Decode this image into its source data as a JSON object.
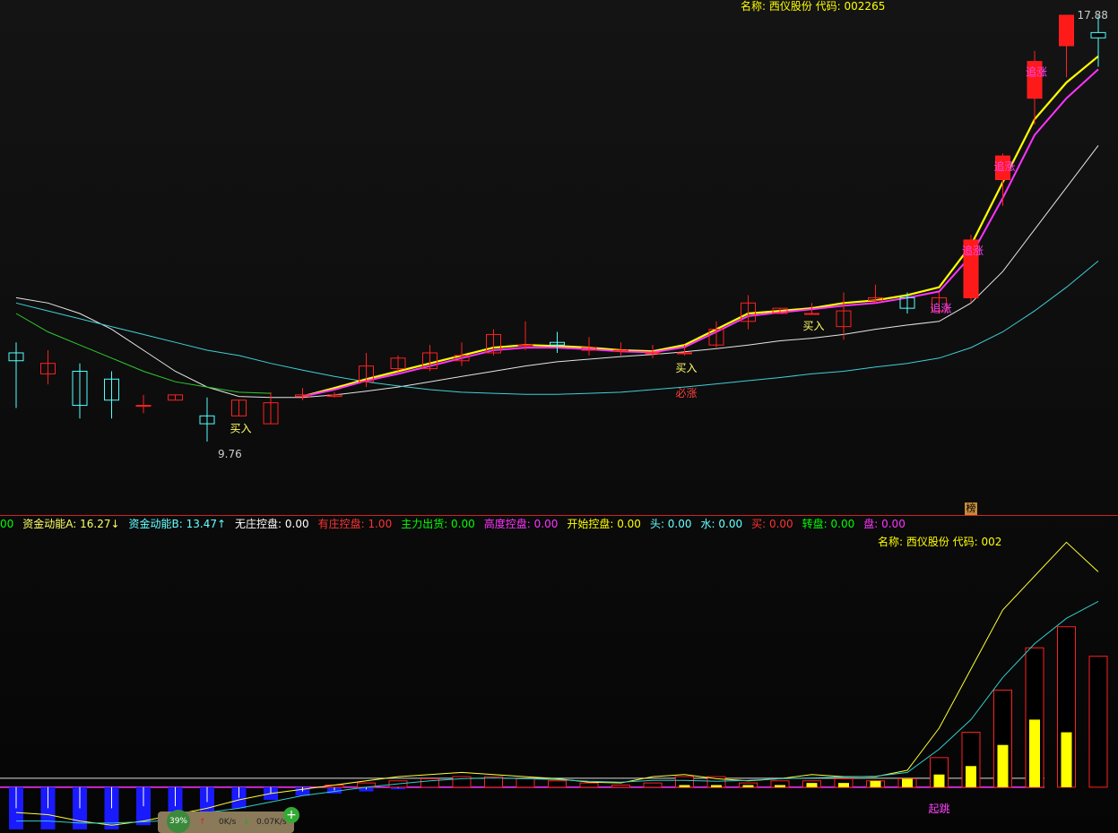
{
  "top_header": {
    "label": "名称: 西仪股份 代码: 002265",
    "color": "#ffff00"
  },
  "bottom_header": {
    "label": "名称: 西仪股份 代码: 002",
    "color": "#ffff00"
  },
  "corner_badge": "榜",
  "indicator_bar": [
    {
      "text": "00",
      "color": "#00ff00"
    },
    {
      "text": "资金动能A: 16.27↓",
      "color": "#ffff66"
    },
    {
      "text": "资金动能B: 13.47↑",
      "color": "#66ffff"
    },
    {
      "text": "无庄控盘: 0.00",
      "color": "#ffffff"
    },
    {
      "text": "有庄控盘: 1.00",
      "color": "#ff3333"
    },
    {
      "text": "主力出货: 0.00",
      "color": "#00ff00"
    },
    {
      "text": "高度控盘: 0.00",
      "color": "#ff33ff"
    },
    {
      "text": "开始控盘: 0.00",
      "color": "#ffff00"
    },
    {
      "text": "头: 0.00",
      "color": "#66ffff"
    },
    {
      "text": "水: 0.00",
      "color": "#66ffff"
    },
    {
      "text": "买: 0.00",
      "color": "#ff3333"
    },
    {
      "text": "转盘: 0.00",
      "color": "#00ff00"
    },
    {
      "text": "盘: 0.00",
      "color": "#ff33ff"
    }
  ],
  "network_widget": {
    "percent": "39%",
    "up_speed": "0K/s",
    "down_speed": "0.07K/s",
    "up_icon": "up-arrow-icon",
    "down_icon": "down-arrow-icon",
    "plus_icon": "plus-icon"
  },
  "colors": {
    "up_candle": "#ff2020",
    "down_candle": "#54ffff",
    "ma_white": "#e6e6e6",
    "ma_cyan": "#3fd0d8",
    "ma_green": "#2ecc2e",
    "trail_yellow": "#ffff00",
    "trail_magenta": "#ff33ff"
  },
  "chart_data": [
    {
      "type": "candlestick",
      "series_name": "西仪股份 002265",
      "y_log": false,
      "ylim": [
        9.3,
        18.0
      ],
      "x": [
        "1",
        "2",
        "3",
        "4",
        "5",
        "6",
        "7",
        "8",
        "9",
        "10",
        "11",
        "12",
        "13",
        "14",
        "15",
        "16",
        "17",
        "18",
        "19",
        "20",
        "21",
        "22",
        "23",
        "24",
        "25",
        "26",
        "27",
        "28",
        "29",
        "30",
        "31",
        "32",
        "33"
      ],
      "ohlc": [
        [
          11.45,
          11.65,
          10.4,
          11.3
        ],
        [
          11.05,
          11.5,
          10.85,
          11.25
        ],
        [
          11.1,
          11.25,
          10.2,
          10.45
        ],
        [
          10.95,
          11.1,
          10.2,
          10.55
        ],
        [
          10.45,
          10.65,
          10.3,
          10.45
        ],
        [
          10.55,
          10.65,
          10.55,
          10.65
        ],
        [
          10.25,
          10.6,
          9.76,
          10.1
        ],
        [
          10.25,
          10.55,
          10.25,
          10.55
        ],
        [
          10.1,
          10.7,
          10.1,
          10.5
        ],
        [
          10.62,
          10.78,
          10.55,
          10.65
        ],
        [
          10.62,
          10.7,
          10.6,
          10.65
        ],
        [
          10.9,
          11.45,
          10.8,
          11.2
        ],
        [
          11.15,
          11.4,
          11.1,
          11.35
        ],
        [
          11.15,
          11.6,
          11.1,
          11.45
        ],
        [
          11.3,
          11.65,
          11.2,
          11.4
        ],
        [
          11.45,
          11.9,
          11.4,
          11.8
        ],
        [
          11.6,
          12.05,
          11.5,
          11.6
        ],
        [
          11.65,
          11.85,
          11.45,
          11.6
        ],
        [
          11.5,
          11.75,
          11.4,
          11.55
        ],
        [
          11.5,
          11.65,
          11.4,
          11.5
        ],
        [
          11.45,
          11.6,
          11.35,
          11.45
        ],
        [
          11.45,
          11.6,
          11.4,
          11.45
        ],
        [
          11.6,
          12.05,
          11.55,
          11.9
        ],
        [
          12.05,
          12.55,
          11.9,
          12.4
        ],
        [
          12.2,
          12.3,
          12.2,
          12.3
        ],
        [
          12.2,
          12.4,
          12.2,
          12.2
        ],
        [
          11.95,
          12.6,
          11.7,
          12.25
        ],
        [
          12.45,
          12.75,
          12.4,
          12.5
        ],
        [
          12.5,
          12.6,
          12.2,
          12.3
        ],
        [
          12.25,
          12.6,
          12.2,
          12.5
        ],
        [
          12.5,
          13.7,
          12.4,
          13.6
        ],
        [
          14.75,
          15.25,
          14.25,
          15.2
        ],
        [
          16.3,
          17.2,
          15.8,
          17.0
        ],
        [
          17.3,
          17.88,
          16.7,
          17.88
        ],
        [
          17.55,
          17.88,
          16.9,
          17.45
        ]
      ],
      "overlays": [
        {
          "name": "MA-white",
          "values": [
            12.5,
            12.4,
            12.2,
            11.9,
            11.5,
            11.1,
            10.8,
            10.62,
            10.6,
            10.6,
            10.65,
            10.72,
            10.8,
            10.9,
            11.0,
            11.1,
            11.2,
            11.28,
            11.33,
            11.38,
            11.42,
            11.47,
            11.53,
            11.6,
            11.68,
            11.73,
            11.8,
            11.9,
            11.98,
            12.05,
            12.4,
            13.0,
            13.8,
            14.6,
            15.4
          ]
        },
        {
          "name": "MA-cyan",
          "values": [
            12.4,
            12.25,
            12.1,
            11.95,
            11.8,
            11.65,
            11.5,
            11.4,
            11.25,
            11.12,
            11.0,
            10.9,
            10.82,
            10.75,
            10.7,
            10.68,
            10.66,
            10.66,
            10.68,
            10.7,
            10.75,
            10.8,
            10.86,
            10.92,
            10.98,
            11.05,
            11.1,
            11.18,
            11.25,
            11.35,
            11.55,
            11.85,
            12.25,
            12.7,
            13.2
          ]
        },
        {
          "name": "MA-green",
          "values": [
            12.2,
            11.85,
            11.6,
            11.35,
            11.1,
            10.9,
            10.8,
            10.7,
            10.68
          ]
        },
        {
          "name": "trail-yellow",
          "values": [
            null,
            null,
            null,
            null,
            null,
            null,
            null,
            null,
            null,
            10.62,
            10.78,
            10.95,
            11.1,
            11.25,
            11.4,
            11.55,
            11.6,
            11.58,
            11.55,
            11.5,
            11.48,
            11.6,
            11.9,
            12.2,
            12.25,
            12.3,
            12.4,
            12.45,
            12.55,
            12.7,
            13.5,
            14.7,
            15.9,
            16.6,
            17.1
          ]
        },
        {
          "name": "trail-magenta",
          "values": [
            null,
            null,
            null,
            null,
            null,
            null,
            null,
            null,
            null,
            10.62,
            10.75,
            10.92,
            11.05,
            11.2,
            11.35,
            11.5,
            11.55,
            11.55,
            11.52,
            11.48,
            11.46,
            11.56,
            11.85,
            12.15,
            12.22,
            12.28,
            12.35,
            12.4,
            12.5,
            12.62,
            13.3,
            14.4,
            15.6,
            16.3,
            16.85
          ]
        }
      ],
      "annotations": [
        {
          "text": "9.76",
          "at_index": 6,
          "color": "#cccccc"
        },
        {
          "text": "17.88",
          "at_index": 33,
          "color": "#cccccc"
        },
        {
          "text": "买入",
          "at_index": 7,
          "color": "#ffff66"
        },
        {
          "text": "买入",
          "at_index": 21,
          "color": "#ffff66"
        },
        {
          "text": "买入",
          "at_index": 25,
          "color": "#ffff66"
        },
        {
          "text": "必涨",
          "at_index": 21,
          "color": "#ff4040"
        },
        {
          "text": "追涨",
          "at_index": 29,
          "color": "#ff44ff"
        },
        {
          "text": "追涨",
          "at_index": 30,
          "color": "#ff44ff"
        },
        {
          "text": "追涨",
          "at_index": 31,
          "color": "#ff44ff"
        },
        {
          "text": "追涨",
          "at_index": 32,
          "color": "#ff44ff"
        }
      ]
    },
    {
      "type": "bar",
      "series_name": "资金动能",
      "zero_line": true,
      "ylim": [
        -1.0,
        6.0
      ],
      "x": [
        "1",
        "2",
        "3",
        "4",
        "5",
        "6",
        "7",
        "8",
        "9",
        "10",
        "11",
        "12",
        "13",
        "14",
        "15",
        "16",
        "17",
        "18",
        "19",
        "20",
        "21",
        "22",
        "23",
        "24",
        "25",
        "26",
        "27",
        "28",
        "29",
        "30",
        "31",
        "32",
        "33"
      ],
      "neg_bars": [
        -1.0,
        -1.0,
        -1.0,
        -1.0,
        -0.9,
        -0.9,
        -0.7,
        -0.5,
        -0.3,
        -0.2,
        -0.15,
        -0.1,
        -0.05,
        -0.02,
        0,
        0,
        0,
        0,
        0,
        0,
        0,
        0,
        0,
        0,
        0,
        0,
        0,
        0,
        0,
        0,
        0,
        0,
        0
      ],
      "pos_bars": [
        0,
        0,
        0,
        0,
        0,
        0,
        0,
        0,
        0,
        0,
        0.05,
        0.1,
        0.15,
        0.2,
        0.25,
        0.25,
        0.2,
        0.15,
        0.1,
        0.05,
        0.1,
        0.25,
        0.25,
        0.1,
        0.15,
        0.15,
        0.2,
        0.15,
        0.2,
        0.7,
        1.3,
        2.3,
        3.3,
        3.8,
        3.1
      ],
      "yellow_bars": [
        0,
        0,
        0,
        0,
        0,
        0,
        0,
        0,
        0,
        0,
        0,
        0,
        0,
        0,
        0,
        0,
        0,
        0,
        0,
        0,
        0,
        0.05,
        0.05,
        0.05,
        0.05,
        0.1,
        0.1,
        0.15,
        0.2,
        0.3,
        0.5,
        1.0,
        1.6,
        1.3
      ],
      "lines": [
        {
          "name": "yellow",
          "values": [
            -0.6,
            -0.65,
            -0.8,
            -0.9,
            -0.8,
            -0.65,
            -0.5,
            -0.3,
            -0.15,
            -0.05,
            0.05,
            0.15,
            0.25,
            0.3,
            0.35,
            0.3,
            0.25,
            0.2,
            0.12,
            0.1,
            0.25,
            0.3,
            0.2,
            0.15,
            0.2,
            0.3,
            0.25,
            0.25,
            0.4,
            1.4,
            2.8,
            4.2,
            5.0,
            5.8,
            5.1
          ]
        },
        {
          "name": "cyan",
          "values": [
            -0.8,
            -0.8,
            -0.85,
            -0.85,
            -0.82,
            -0.78,
            -0.6,
            -0.5,
            -0.35,
            -0.2,
            -0.1,
            0.0,
            0.08,
            0.15,
            0.2,
            0.22,
            0.2,
            0.18,
            0.14,
            0.12,
            0.16,
            0.16,
            0.14,
            0.16,
            0.2,
            0.22,
            0.24,
            0.26,
            0.35,
            0.9,
            1.6,
            2.6,
            3.4,
            4.0,
            4.4
          ]
        }
      ],
      "annotations": [
        {
          "text": "起跳",
          "at_index": 29,
          "color": "#ff44ff"
        }
      ]
    }
  ]
}
